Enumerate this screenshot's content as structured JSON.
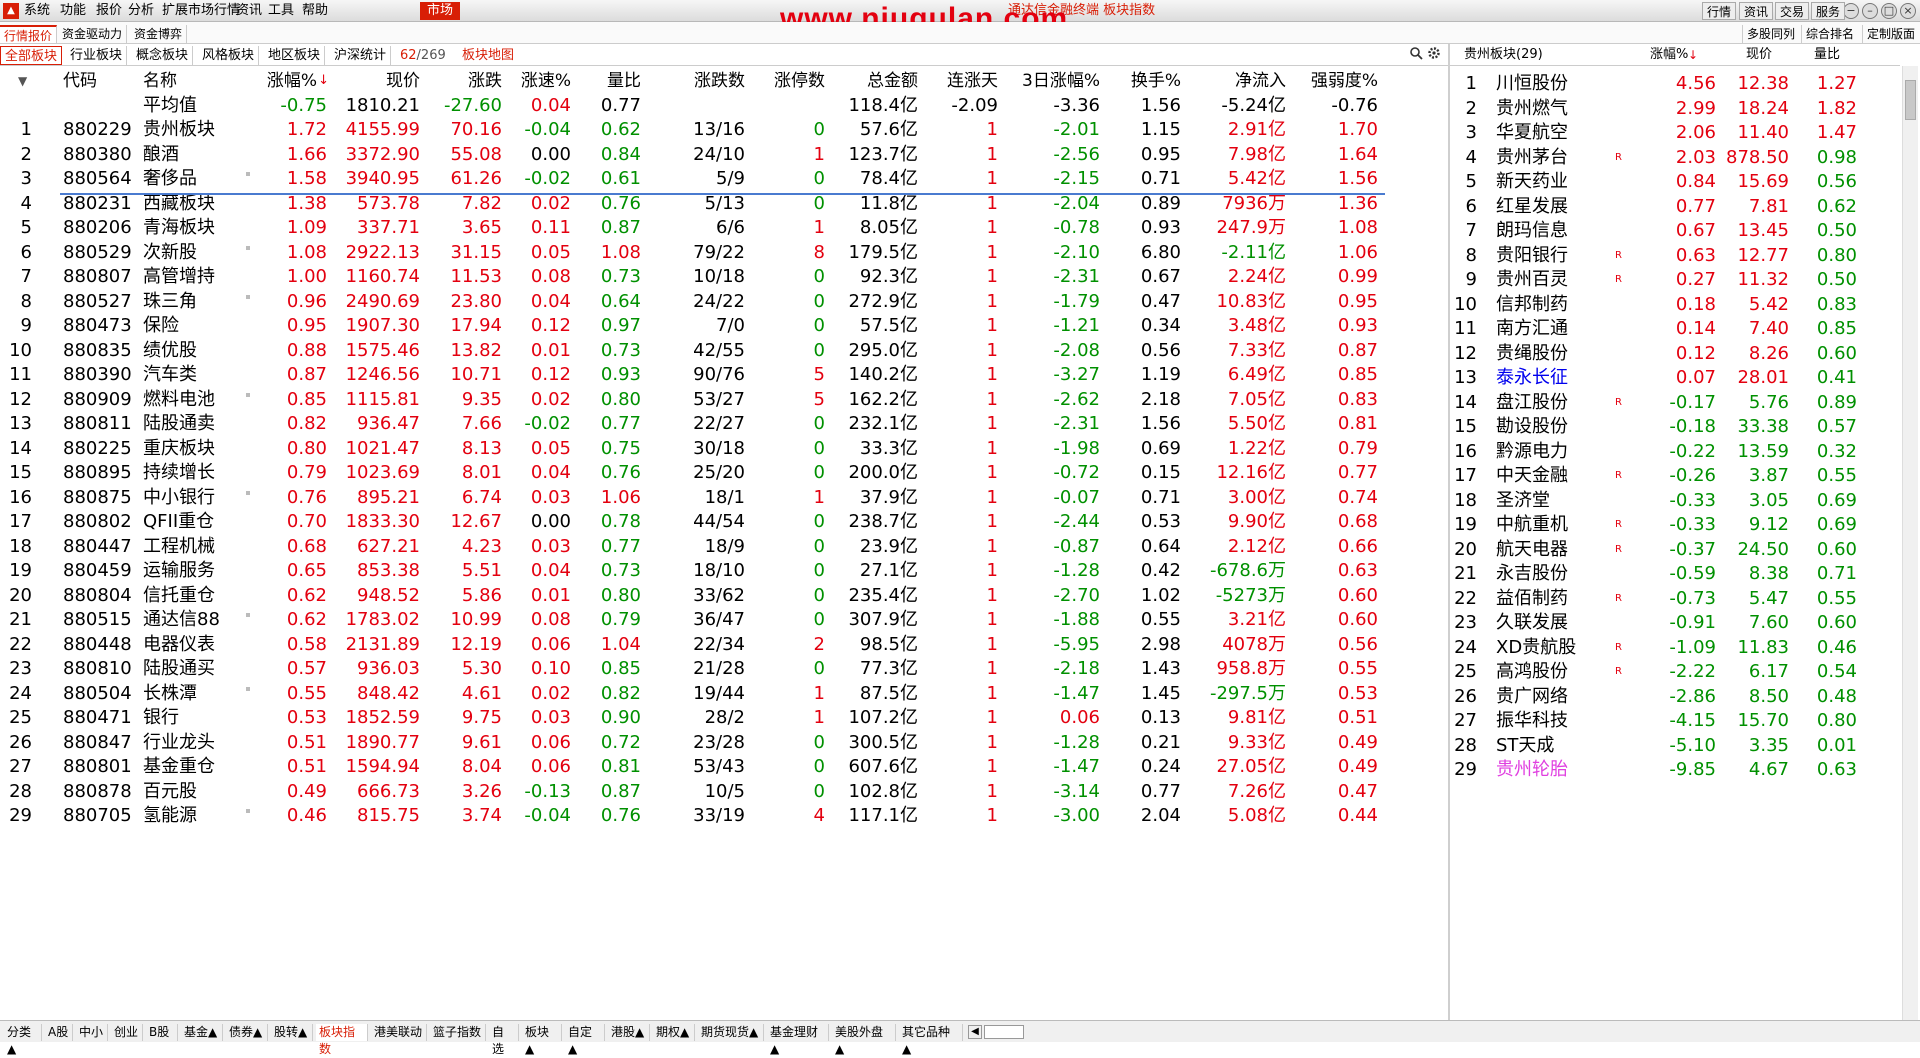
{
  "titlebar": {
    "menus": [
      "系统",
      "功能",
      "报价",
      "分析",
      "扩展市场行情",
      "资讯",
      "工具",
      "帮助"
    ],
    "active_menu": "市场",
    "app_title": "通达信金融终端  板块指数",
    "watermark": "www.niugulan.com",
    "right_buttons": [
      "行情",
      "资讯",
      "交易",
      "服务"
    ]
  },
  "top_tabs": {
    "items": [
      "行情报价",
      "资金驱动力",
      "资金博弈"
    ],
    "right_items": [
      "多股同列",
      "综合排名",
      "定制版面"
    ]
  },
  "sub_tabs": {
    "items": [
      "全部板块",
      "行业板块",
      "概念板块",
      "风格板块",
      "地区板块",
      "沪深统计"
    ],
    "count_current": "62",
    "count_total": "/269",
    "block_map": "板块地图"
  },
  "table": {
    "headers": [
      "代码",
      "名称",
      "涨幅%",
      "现价",
      "涨跌",
      "涨速%",
      "量比",
      "涨跌数",
      "涨停数",
      "总金额",
      "连涨天",
      "3日涨幅%",
      "换手%",
      "净流入",
      "强弱度%"
    ],
    "sort_arrow": "↓",
    "average": {
      "label": "平均值",
      "change_pct": "-0.75",
      "price": "1810.21",
      "change": "-27.60",
      "speed": "0.04",
      "vol_ratio": "0.77",
      "turnover_amt": "118.4亿",
      "up_days": "-2.09",
      "change3d": "-3.36",
      "turnover": "1.56",
      "net_inflow": "-5.24亿",
      "strength": "-0.76"
    },
    "rows": [
      {
        "n": "1",
        "code": "880229",
        "name": "贵州板块",
        "m": false,
        "pct": "1.72",
        "price": "4155.99",
        "chg": "70.16",
        "speed": "-0.04",
        "vr": "0.62",
        "ud": "13/16",
        "lu": "0",
        "amt": "57.6亿",
        "days": "1",
        "d3": "-2.01",
        "to": "1.15",
        "net": "2.91亿",
        "str": "1.70"
      },
      {
        "n": "2",
        "code": "880380",
        "name": "酿酒",
        "m": false,
        "pct": "1.66",
        "price": "3372.90",
        "chg": "55.08",
        "speed": "0.00",
        "vr": "0.84",
        "ud": "24/10",
        "lu": "1",
        "amt": "123.7亿",
        "days": "1",
        "d3": "-2.56",
        "to": "0.95",
        "net": "7.98亿",
        "str": "1.64"
      },
      {
        "n": "3",
        "code": "880564",
        "name": "奢侈品",
        "m": true,
        "pct": "1.58",
        "price": "3940.95",
        "chg": "61.26",
        "speed": "-0.02",
        "vr": "0.61",
        "ud": "5/9",
        "lu": "0",
        "amt": "78.4亿",
        "days": "1",
        "d3": "-2.15",
        "to": "0.71",
        "net": "5.42亿",
        "str": "1.56"
      },
      {
        "n": "4",
        "code": "880231",
        "name": "西藏板块",
        "m": false,
        "pct": "1.38",
        "price": "573.78",
        "chg": "7.82",
        "speed": "0.02",
        "vr": "0.76",
        "ud": "5/13",
        "lu": "0",
        "amt": "11.8亿",
        "days": "1",
        "d3": "-2.04",
        "to": "0.89",
        "net": "7936万",
        "str": "1.36"
      },
      {
        "n": "5",
        "code": "880206",
        "name": "青海板块",
        "m": false,
        "pct": "1.09",
        "price": "337.71",
        "chg": "3.65",
        "speed": "0.11",
        "vr": "0.87",
        "ud": "6/6",
        "lu": "1",
        "amt": "8.05亿",
        "days": "1",
        "d3": "-0.78",
        "to": "0.93",
        "net": "247.9万",
        "str": "1.08"
      },
      {
        "n": "6",
        "code": "880529",
        "name": "次新股",
        "m": true,
        "pct": "1.08",
        "price": "2922.13",
        "chg": "31.15",
        "speed": "0.05",
        "vr": "1.08",
        "ud": "79/22",
        "lu": "8",
        "amt": "179.5亿",
        "days": "1",
        "d3": "-2.10",
        "to": "6.80",
        "net": "-2.11亿",
        "str": "1.06"
      },
      {
        "n": "7",
        "code": "880807",
        "name": "高管增持",
        "m": false,
        "pct": "1.00",
        "price": "1160.74",
        "chg": "11.53",
        "speed": "0.08",
        "vr": "0.73",
        "ud": "10/18",
        "lu": "0",
        "amt": "92.3亿",
        "days": "1",
        "d3": "-2.31",
        "to": "0.67",
        "net": "2.24亿",
        "str": "0.99"
      },
      {
        "n": "8",
        "code": "880527",
        "name": "珠三角",
        "m": true,
        "pct": "0.96",
        "price": "2490.69",
        "chg": "23.80",
        "speed": "0.04",
        "vr": "0.64",
        "ud": "24/22",
        "lu": "0",
        "amt": "272.9亿",
        "days": "1",
        "d3": "-1.79",
        "to": "0.47",
        "net": "10.83亿",
        "str": "0.95"
      },
      {
        "n": "9",
        "code": "880473",
        "name": "保险",
        "m": false,
        "pct": "0.95",
        "price": "1907.30",
        "chg": "17.94",
        "speed": "0.12",
        "vr": "0.97",
        "ud": "7/0",
        "lu": "0",
        "amt": "57.5亿",
        "days": "1",
        "d3": "-1.21",
        "to": "0.34",
        "net": "3.48亿",
        "str": "0.93"
      },
      {
        "n": "10",
        "code": "880835",
        "name": "绩优股",
        "m": false,
        "pct": "0.88",
        "price": "1575.46",
        "chg": "13.82",
        "speed": "0.01",
        "vr": "0.73",
        "ud": "42/55",
        "lu": "0",
        "amt": "295.0亿",
        "days": "1",
        "d3": "-2.08",
        "to": "0.56",
        "net": "7.33亿",
        "str": "0.87"
      },
      {
        "n": "11",
        "code": "880390",
        "name": "汽车类",
        "m": false,
        "pct": "0.87",
        "price": "1246.56",
        "chg": "10.71",
        "speed": "0.12",
        "vr": "0.93",
        "ud": "90/76",
        "lu": "5",
        "amt": "140.2亿",
        "days": "1",
        "d3": "-3.27",
        "to": "1.19",
        "net": "6.49亿",
        "str": "0.85"
      },
      {
        "n": "12",
        "code": "880909",
        "name": "燃料电池",
        "m": true,
        "pct": "0.85",
        "price": "1115.81",
        "chg": "9.35",
        "speed": "0.02",
        "vr": "0.80",
        "ud": "53/27",
        "lu": "5",
        "amt": "162.2亿",
        "days": "1",
        "d3": "-2.62",
        "to": "2.18",
        "net": "7.05亿",
        "str": "0.83"
      },
      {
        "n": "13",
        "code": "880811",
        "name": "陆股通卖",
        "m": false,
        "pct": "0.82",
        "price": "936.47",
        "chg": "7.66",
        "speed": "-0.02",
        "vr": "0.77",
        "ud": "22/27",
        "lu": "0",
        "amt": "232.1亿",
        "days": "1",
        "d3": "-2.31",
        "to": "1.56",
        "net": "5.50亿",
        "str": "0.81"
      },
      {
        "n": "14",
        "code": "880225",
        "name": "重庆板块",
        "m": false,
        "pct": "0.80",
        "price": "1021.47",
        "chg": "8.13",
        "speed": "0.05",
        "vr": "0.75",
        "ud": "30/18",
        "lu": "0",
        "amt": "33.3亿",
        "days": "1",
        "d3": "-1.98",
        "to": "0.69",
        "net": "1.22亿",
        "str": "0.79"
      },
      {
        "n": "15",
        "code": "880895",
        "name": "持续增长",
        "m": false,
        "pct": "0.79",
        "price": "1023.69",
        "chg": "8.01",
        "speed": "0.04",
        "vr": "0.76",
        "ud": "25/20",
        "lu": "0",
        "amt": "200.0亿",
        "days": "1",
        "d3": "-0.72",
        "to": "0.15",
        "net": "12.16亿",
        "str": "0.77"
      },
      {
        "n": "16",
        "code": "880875",
        "name": "中小银行",
        "m": true,
        "pct": "0.76",
        "price": "895.21",
        "chg": "6.74",
        "speed": "0.03",
        "vr": "1.06",
        "ud": "18/1",
        "lu": "1",
        "amt": "37.9亿",
        "days": "1",
        "d3": "-0.07",
        "to": "0.71",
        "net": "3.00亿",
        "str": "0.74"
      },
      {
        "n": "17",
        "code": "880802",
        "name": "QFII重仓",
        "m": false,
        "pct": "0.70",
        "price": "1833.30",
        "chg": "12.67",
        "speed": "0.00",
        "vr": "0.78",
        "ud": "44/54",
        "lu": "0",
        "amt": "238.7亿",
        "days": "1",
        "d3": "-2.44",
        "to": "0.53",
        "net": "9.90亿",
        "str": "0.68"
      },
      {
        "n": "18",
        "code": "880447",
        "name": "工程机械",
        "m": false,
        "pct": "0.68",
        "price": "627.21",
        "chg": "4.23",
        "speed": "0.03",
        "vr": "0.77",
        "ud": "18/9",
        "lu": "0",
        "amt": "23.9亿",
        "days": "1",
        "d3": "-0.87",
        "to": "0.64",
        "net": "2.12亿",
        "str": "0.66"
      },
      {
        "n": "19",
        "code": "880459",
        "name": "运输服务",
        "m": false,
        "pct": "0.65",
        "price": "853.38",
        "chg": "5.51",
        "speed": "0.04",
        "vr": "0.73",
        "ud": "18/10",
        "lu": "0",
        "amt": "27.1亿",
        "days": "1",
        "d3": "-1.28",
        "to": "0.42",
        "net": "-678.6万",
        "str": "0.63"
      },
      {
        "n": "20",
        "code": "880804",
        "name": "信托重仓",
        "m": false,
        "pct": "0.62",
        "price": "948.52",
        "chg": "5.86",
        "speed": "0.01",
        "vr": "0.80",
        "ud": "33/62",
        "lu": "0",
        "amt": "235.4亿",
        "days": "1",
        "d3": "-2.70",
        "to": "1.02",
        "net": "-5273万",
        "str": "0.60"
      },
      {
        "n": "21",
        "code": "880515",
        "name": "通达信88",
        "m": true,
        "pct": "0.62",
        "price": "1783.02",
        "chg": "10.99",
        "speed": "0.08",
        "vr": "0.79",
        "ud": "36/47",
        "lu": "0",
        "amt": "307.9亿",
        "days": "1",
        "d3": "-1.88",
        "to": "0.55",
        "net": "3.21亿",
        "str": "0.60"
      },
      {
        "n": "22",
        "code": "880448",
        "name": "电器仪表",
        "m": false,
        "pct": "0.58",
        "price": "2131.89",
        "chg": "12.19",
        "speed": "0.06",
        "vr": "1.04",
        "ud": "22/34",
        "lu": "2",
        "amt": "98.5亿",
        "days": "1",
        "d3": "-5.95",
        "to": "2.98",
        "net": "4078万",
        "str": "0.56"
      },
      {
        "n": "23",
        "code": "880810",
        "name": "陆股通买",
        "m": false,
        "pct": "0.57",
        "price": "936.03",
        "chg": "5.30",
        "speed": "0.10",
        "vr": "0.85",
        "ud": "21/28",
        "lu": "0",
        "amt": "77.3亿",
        "days": "1",
        "d3": "-2.18",
        "to": "1.43",
        "net": "958.8万",
        "str": "0.55"
      },
      {
        "n": "24",
        "code": "880504",
        "name": "长株潭",
        "m": true,
        "pct": "0.55",
        "price": "848.42",
        "chg": "4.61",
        "speed": "0.02",
        "vr": "0.82",
        "ud": "19/44",
        "lu": "1",
        "amt": "87.5亿",
        "days": "1",
        "d3": "-1.47",
        "to": "1.45",
        "net": "-297.5万",
        "str": "0.53"
      },
      {
        "n": "25",
        "code": "880471",
        "name": "银行",
        "m": false,
        "pct": "0.53",
        "price": "1852.59",
        "chg": "9.75",
        "speed": "0.03",
        "vr": "0.90",
        "ud": "28/2",
        "lu": "1",
        "amt": "107.2亿",
        "days": "1",
        "d3": "0.06",
        "to": "0.13",
        "net": "9.81亿",
        "str": "0.51"
      },
      {
        "n": "26",
        "code": "880847",
        "name": "行业龙头",
        "m": false,
        "pct": "0.51",
        "price": "1890.77",
        "chg": "9.61",
        "speed": "0.06",
        "vr": "0.72",
        "ud": "23/28",
        "lu": "0",
        "amt": "300.5亿",
        "days": "1",
        "d3": "-1.28",
        "to": "0.21",
        "net": "9.33亿",
        "str": "0.49"
      },
      {
        "n": "27",
        "code": "880801",
        "name": "基金重仓",
        "m": false,
        "pct": "0.51",
        "price": "1594.94",
        "chg": "8.04",
        "speed": "0.06",
        "vr": "0.81",
        "ud": "53/43",
        "lu": "0",
        "amt": "607.6亿",
        "days": "1",
        "d3": "-1.47",
        "to": "0.24",
        "net": "27.05亿",
        "str": "0.49"
      },
      {
        "n": "28",
        "code": "880878",
        "name": "百元股",
        "m": false,
        "pct": "0.49",
        "price": "666.73",
        "chg": "3.26",
        "speed": "-0.13",
        "vr": "0.87",
        "ud": "10/5",
        "lu": "0",
        "amt": "102.8亿",
        "days": "1",
        "d3": "-3.14",
        "to": "0.77",
        "net": "7.26亿",
        "str": "0.47"
      },
      {
        "n": "29",
        "code": "880705",
        "name": "氢能源",
        "m": true,
        "pct": "0.46",
        "price": "815.75",
        "chg": "3.74",
        "speed": "-0.04",
        "vr": "0.76",
        "ud": "33/19",
        "lu": "4",
        "amt": "117.1亿",
        "days": "1",
        "d3": "-3.00",
        "to": "2.04",
        "net": "5.08亿",
        "str": "0.44"
      }
    ]
  },
  "right_panel": {
    "title": "贵州板块(29)",
    "headers": [
      "涨幅%",
      "现价",
      "量比"
    ],
    "sort_arrow": "↓",
    "rows": [
      {
        "n": "1",
        "name": "川恒股份",
        "r": "",
        "pct": "4.56",
        "price": "12.38",
        "vr": "1.27",
        "nc": "k"
      },
      {
        "n": "2",
        "name": "贵州燃气",
        "r": "",
        "pct": "2.99",
        "price": "18.24",
        "vr": "1.82",
        "nc": "k"
      },
      {
        "n": "3",
        "name": "华夏航空",
        "r": "",
        "pct": "2.06",
        "price": "11.40",
        "vr": "1.47",
        "nc": "k"
      },
      {
        "n": "4",
        "name": "贵州茅台",
        "r": "R",
        "pct": "2.03",
        "price": "878.50",
        "vr": "0.98",
        "nc": "k"
      },
      {
        "n": "5",
        "name": "新天药业",
        "r": "",
        "pct": "0.84",
        "price": "15.69",
        "vr": "0.56",
        "nc": "k"
      },
      {
        "n": "6",
        "name": "红星发展",
        "r": "",
        "pct": "0.77",
        "price": "7.81",
        "vr": "0.62",
        "nc": "k"
      },
      {
        "n": "7",
        "name": "朗玛信息",
        "r": "",
        "pct": "0.67",
        "price": "13.45",
        "vr": "0.50",
        "nc": "k"
      },
      {
        "n": "8",
        "name": "贵阳银行",
        "r": "R",
        "pct": "0.63",
        "price": "12.77",
        "vr": "0.80",
        "nc": "k"
      },
      {
        "n": "9",
        "name": "贵州百灵",
        "r": "R",
        "pct": "0.27",
        "price": "11.32",
        "vr": "0.50",
        "nc": "k"
      },
      {
        "n": "10",
        "name": "信邦制药",
        "r": "",
        "pct": "0.18",
        "price": "5.42",
        "vr": "0.83",
        "nc": "k"
      },
      {
        "n": "11",
        "name": "南方汇通",
        "r": "",
        "pct": "0.14",
        "price": "7.40",
        "vr": "0.85",
        "nc": "k"
      },
      {
        "n": "12",
        "name": "贵绳股份",
        "r": "",
        "pct": "0.12",
        "price": "8.26",
        "vr": "0.60",
        "nc": "k"
      },
      {
        "n": "13",
        "name": "泰永长征",
        "r": "",
        "pct": "0.07",
        "price": "28.01",
        "vr": "0.41",
        "nc": "b"
      },
      {
        "n": "14",
        "name": "盘江股份",
        "r": "R",
        "pct": "-0.17",
        "price": "5.76",
        "vr": "0.89",
        "nc": "k"
      },
      {
        "n": "15",
        "name": "勘设股份",
        "r": "",
        "pct": "-0.18",
        "price": "33.38",
        "vr": "0.57",
        "nc": "k"
      },
      {
        "n": "16",
        "name": "黔源电力",
        "r": "",
        "pct": "-0.22",
        "price": "13.59",
        "vr": "0.32",
        "nc": "k"
      },
      {
        "n": "17",
        "name": "中天金融",
        "r": "R",
        "pct": "-0.26",
        "price": "3.87",
        "vr": "0.55",
        "nc": "k"
      },
      {
        "n": "18",
        "name": "圣济堂",
        "r": "",
        "pct": "-0.33",
        "price": "3.05",
        "vr": "0.69",
        "nc": "k"
      },
      {
        "n": "19",
        "name": "中航重机",
        "r": "R",
        "pct": "-0.33",
        "price": "9.12",
        "vr": "0.69",
        "nc": "k"
      },
      {
        "n": "20",
        "name": "航天电器",
        "r": "R",
        "pct": "-0.37",
        "price": "24.50",
        "vr": "0.60",
        "nc": "k"
      },
      {
        "n": "21",
        "name": "永吉股份",
        "r": "",
        "pct": "-0.59",
        "price": "8.38",
        "vr": "0.71",
        "nc": "k"
      },
      {
        "n": "22",
        "name": "益佰制药",
        "r": "R",
        "pct": "-0.73",
        "price": "5.47",
        "vr": "0.55",
        "nc": "k"
      },
      {
        "n": "23",
        "name": "久联发展",
        "r": "",
        "pct": "-0.91",
        "price": "7.60",
        "vr": "0.60",
        "nc": "k"
      },
      {
        "n": "24",
        "name": "XD贵航股",
        "r": "R",
        "pct": "-1.09",
        "price": "11.83",
        "vr": "0.46",
        "nc": "k"
      },
      {
        "n": "25",
        "name": "高鸿股份",
        "r": "R",
        "pct": "-2.22",
        "price": "6.17",
        "vr": "0.54",
        "nc": "k"
      },
      {
        "n": "26",
        "name": "贵广网络",
        "r": "",
        "pct": "-2.86",
        "price": "8.50",
        "vr": "0.48",
        "nc": "k"
      },
      {
        "n": "27",
        "name": "振华科技",
        "r": "",
        "pct": "-4.15",
        "price": "15.70",
        "vr": "0.80",
        "nc": "k"
      },
      {
        "n": "28",
        "name": "ST天成",
        "r": "",
        "pct": "-5.10",
        "price": "3.35",
        "vr": "0.01",
        "nc": "k"
      },
      {
        "n": "29",
        "name": "贵州轮胎",
        "r": "",
        "pct": "-9.85",
        "price": "4.67",
        "vr": "0.63",
        "nc": "p"
      }
    ]
  },
  "bottom_tabs": [
    "分类▲",
    "A股",
    "中小",
    "创业",
    "B股",
    "基金▲",
    "债券▲",
    "股转▲",
    "板块指数",
    "港美联动",
    "篮子指数",
    "自选",
    "板块▲",
    "自定▲",
    "港股▲",
    "期权▲",
    "期货现货▲",
    "基金理财▲",
    "美股外盘▲",
    "其它品种▲"
  ],
  "bottom_active": "板块指数",
  "colors": {
    "up": "#e3000f",
    "down": "#009000",
    "accent": "#d81e06",
    "selection": "#4a7bd0"
  }
}
